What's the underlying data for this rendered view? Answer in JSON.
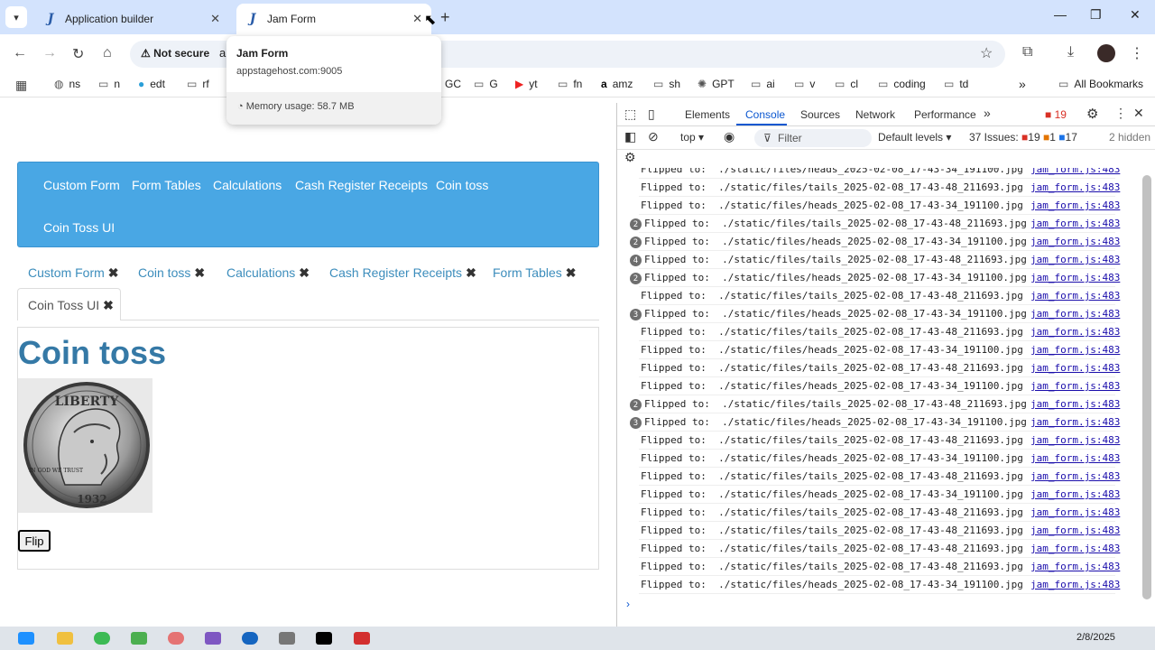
{
  "browser": {
    "tabs": [
      {
        "label": "Application builder"
      },
      {
        "label": "Jam Form"
      }
    ],
    "tab_icon_letter": "J",
    "security_label": "Not secure",
    "url_fragment": "a",
    "bookmarks": [
      "ns",
      "n",
      "edt",
      "rf",
      "GC",
      "G",
      "yt",
      "fn",
      "amz",
      "sh",
      "GPT",
      "ai",
      "v",
      "cl",
      "coding",
      "td"
    ],
    "all_bookmarks_label": "All Bookmarks",
    "hover_card": {
      "title": "Jam Form",
      "host": "appstagehost.com:9005",
      "memory": "Memory usage: 58.7 MB"
    }
  },
  "page": {
    "navbar_links": [
      "Custom Form",
      "Form Tables",
      "Calculations",
      "Cash Register Receipts",
      "Coin toss",
      "Coin Toss UI"
    ],
    "open_tabs": [
      "Custom Form",
      "Coin toss",
      "Calculations",
      "Cash Register Receipts",
      "Form Tables"
    ],
    "active_tab": "Coin Toss UI",
    "close_glyph": "✖",
    "heading": "Coin toss",
    "coin_text": {
      "top": "LIBERTY",
      "left": "IN GOD WE TRUST",
      "bottom": "1932"
    },
    "flip_button": "Flip"
  },
  "devtools": {
    "tabs": [
      "Elements",
      "Console",
      "Sources",
      "Network",
      "Performance"
    ],
    "errors_badge": "19",
    "context": "top",
    "filter_placeholder": "Filter",
    "levels": "Default levels",
    "issues_label": "37 Issues:",
    "issue_counts": {
      "errors": "19",
      "warnings": "1",
      "info": "17"
    },
    "hidden_label": "2 hidden",
    "log_source": "jam_form.js:483",
    "log_lines": [
      {
        "count": "",
        "msg": "Flipped to:  ./static/files/heads_2025-02-08_17-43-34_191100.jpg"
      },
      {
        "count": "",
        "msg": "Flipped to:  ./static/files/tails_2025-02-08_17-43-48_211693.jpg"
      },
      {
        "count": "",
        "msg": "Flipped to:  ./static/files/heads_2025-02-08_17-43-34_191100.jpg"
      },
      {
        "count": "2",
        "msg": "Flipped to:  ./static/files/tails_2025-02-08_17-43-48_211693.jpg"
      },
      {
        "count": "2",
        "msg": "Flipped to:  ./static/files/heads_2025-02-08_17-43-34_191100.jpg"
      },
      {
        "count": "4",
        "msg": "Flipped to:  ./static/files/tails_2025-02-08_17-43-48_211693.jpg"
      },
      {
        "count": "2",
        "msg": "Flipped to:  ./static/files/heads_2025-02-08_17-43-34_191100.jpg"
      },
      {
        "count": "",
        "msg": "Flipped to:  ./static/files/tails_2025-02-08_17-43-48_211693.jpg"
      },
      {
        "count": "3",
        "msg": "Flipped to:  ./static/files/heads_2025-02-08_17-43-34_191100.jpg"
      },
      {
        "count": "",
        "msg": "Flipped to:  ./static/files/tails_2025-02-08_17-43-48_211693.jpg"
      },
      {
        "count": "",
        "msg": "Flipped to:  ./static/files/heads_2025-02-08_17-43-34_191100.jpg"
      },
      {
        "count": "",
        "msg": "Flipped to:  ./static/files/tails_2025-02-08_17-43-48_211693.jpg"
      },
      {
        "count": "",
        "msg": "Flipped to:  ./static/files/heads_2025-02-08_17-43-34_191100.jpg"
      },
      {
        "count": "2",
        "msg": "Flipped to:  ./static/files/tails_2025-02-08_17-43-48_211693.jpg"
      },
      {
        "count": "3",
        "msg": "Flipped to:  ./static/files/heads_2025-02-08_17-43-34_191100.jpg"
      },
      {
        "count": "",
        "msg": "Flipped to:  ./static/files/tails_2025-02-08_17-43-48_211693.jpg"
      },
      {
        "count": "",
        "msg": "Flipped to:  ./static/files/heads_2025-02-08_17-43-34_191100.jpg"
      },
      {
        "count": "",
        "msg": "Flipped to:  ./static/files/tails_2025-02-08_17-43-48_211693.jpg"
      },
      {
        "count": "",
        "msg": "Flipped to:  ./static/files/heads_2025-02-08_17-43-34_191100.jpg"
      },
      {
        "count": "",
        "msg": "Flipped to:  ./static/files/tails_2025-02-08_17-43-48_211693.jpg"
      },
      {
        "count": "",
        "msg": "Flipped to:  ./static/files/tails_2025-02-08_17-43-48_211693.jpg"
      },
      {
        "count": "",
        "msg": "Flipped to:  ./static/files/tails_2025-02-08_17-43-48_211693.jpg"
      },
      {
        "count": "",
        "msg": "Flipped to:  ./static/files/tails_2025-02-08_17-43-48_211693.jpg"
      },
      {
        "count": "",
        "msg": "Flipped to:  ./static/files/heads_2025-02-08_17-43-34_191100.jpg"
      }
    ],
    "prompt": "›"
  },
  "taskbar": {
    "date": "2/8/2025"
  }
}
